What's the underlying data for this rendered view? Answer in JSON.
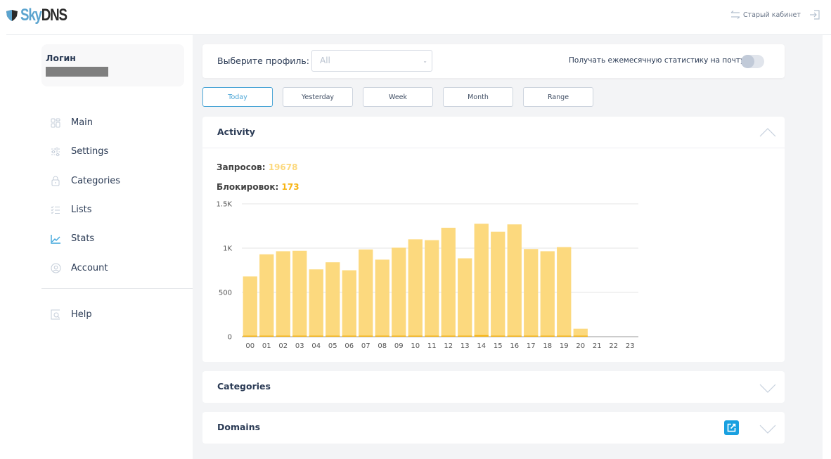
{
  "header": {
    "logo": {
      "sky": "Sky",
      "dns": "DNS"
    },
    "old_cabinet_label": "Старый кабинет",
    "icons": {
      "old_cabinet": "swap-arrows-icon",
      "logout": "logout-icon"
    }
  },
  "sidebar": {
    "login_label": "Логин",
    "login_value": "",
    "items": [
      {
        "label": "Main",
        "icon": "dashboard-grid-icon",
        "active": false
      },
      {
        "label": "Settings",
        "icon": "sliders-icon",
        "active": false
      },
      {
        "label": "Categories",
        "icon": "lock-icon",
        "active": false
      },
      {
        "label": "Lists",
        "icon": "checklist-icon",
        "active": false
      },
      {
        "label": "Stats",
        "icon": "line-chart-icon",
        "active": true
      },
      {
        "label": "Account",
        "icon": "user-circle-icon",
        "active": false
      }
    ],
    "help": {
      "label": "Help",
      "icon": "help-search-icon"
    }
  },
  "profile": {
    "label": "Выберите профиль:",
    "selected": "All",
    "monthly_stats_label": "Получать ежемесячную статистику на почту",
    "monthly_stats_enabled": false
  },
  "periods": [
    {
      "label": "Today",
      "active": true
    },
    {
      "label": "Yesterday",
      "active": false
    },
    {
      "label": "Week",
      "active": false
    },
    {
      "label": "Month",
      "active": false
    },
    {
      "label": "Range",
      "active": false
    }
  ],
  "activity": {
    "title": "Activity",
    "requests_label": "Запросов:",
    "requests_value": "19678",
    "blocks_label": "Блокировок:",
    "blocks_value": "173",
    "expanded": true
  },
  "sections": {
    "categories": {
      "title": "Categories",
      "expanded": false
    },
    "domains": {
      "title": "Domains",
      "expanded": false
    }
  },
  "colors": {
    "requests": "#fcd97e",
    "blocks": "#f7b515",
    "accent": "#4aa5d6",
    "export": "#19a0e0"
  },
  "chart_data": {
    "type": "bar",
    "stacked": true,
    "title": "",
    "xlabel": "",
    "ylabel": "",
    "categories": [
      "00",
      "01",
      "02",
      "03",
      "04",
      "05",
      "06",
      "07",
      "08",
      "09",
      "10",
      "11",
      "12",
      "13",
      "14",
      "15",
      "16",
      "17",
      "18",
      "19",
      "20",
      "21",
      "22",
      "23"
    ],
    "series": [
      {
        "name": "Запросов",
        "color": "#fcd97e",
        "values": [
          680,
          930,
          965,
          970,
          760,
          840,
          750,
          985,
          870,
          1005,
          1100,
          1090,
          1230,
          885,
          1275,
          1185,
          1268,
          990,
          965,
          1012,
          90,
          0,
          0,
          0
        ]
      },
      {
        "name": "Блокировок",
        "color": "#f7b515",
        "values": [
          2,
          10,
          12,
          3,
          2,
          2,
          2,
          3,
          12,
          8,
          12,
          12,
          10,
          3,
          18,
          12,
          12,
          10,
          10,
          3,
          2,
          0,
          0,
          0
        ]
      }
    ],
    "yticks": [
      0,
      500,
      1000,
      1500
    ],
    "ytick_labels": [
      "0",
      "500",
      "1K",
      "1.5K"
    ],
    "ylim": [
      0,
      1500
    ],
    "grid": true,
    "legend": "none"
  }
}
